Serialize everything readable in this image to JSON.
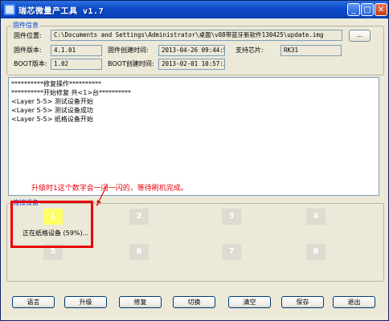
{
  "window": {
    "title": "瑞芯微量产工具 v1.7"
  },
  "firmware": {
    "group_title": "固件信息",
    "path_label": "固件位置:",
    "path_value": "C:\\Documents and Settings\\Administrator\\桌面\\v88带蓝牙新软件130425\\update.img",
    "browse_label": "...",
    "version_label": "固件版本:",
    "version_value": "4.1.01",
    "created_label": "固件创建时间:",
    "created_value": "2013-04-26 09:44:53",
    "chip_label": "支持芯片:",
    "chip_value": "RK31",
    "boot_version_label": "BOOT版本:",
    "boot_version_value": "1.02",
    "boot_created_label": "BOOT创建时间:",
    "boot_created_value": "2013-02-01 10:57:34"
  },
  "log": {
    "lines": [
      "**********修复操作**********",
      "**********开始修复 共<1>台**********",
      "<Layer 5-5> 测试设备开始",
      "<Layer 5-5> 测试设备成功",
      "<Layer 5-5> 纸格设备开始"
    ]
  },
  "annotation": {
    "text": "升级时1这个数字会一闪一闪的，等待刷机完成。",
    "color": "#e8000d"
  },
  "devices": {
    "group_title": "连接设备",
    "slots": [
      "1",
      "2",
      "3",
      "4",
      "5",
      "6",
      "7",
      "8"
    ],
    "active_slot": "1",
    "progress_text": "正在纸格设备 (59%)...",
    "progress_percent": 59
  },
  "buttons": {
    "language": "语言",
    "upgrade": "升级",
    "repair": "修复",
    "switch": "切换",
    "clear": "清空",
    "save": "保存",
    "exit": "退出"
  }
}
